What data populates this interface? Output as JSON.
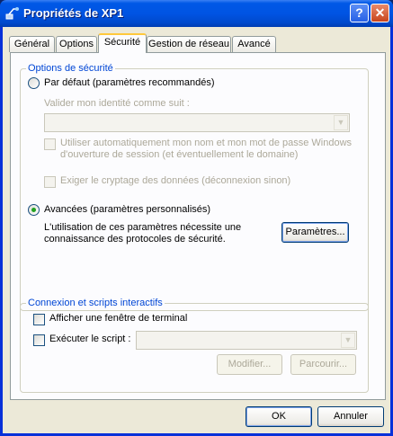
{
  "window": {
    "title": "Propriétés de XP1",
    "help_label": "?",
    "close_label": "✕"
  },
  "tabs": [
    {
      "label": "Général",
      "active": false
    },
    {
      "label": "Options",
      "active": false
    },
    {
      "label": "Sécurité",
      "active": true
    },
    {
      "label": "Gestion de réseau",
      "active": false
    },
    {
      "label": "Avancé",
      "active": false
    }
  ],
  "security_options": {
    "group_title": "Options de sécurité",
    "default_radio_label": "Par défaut (paramètres recommandés)",
    "default_checked": false,
    "validate_label": "Valider mon identité comme suit :",
    "validate_value": "",
    "auto_credentials_label_line1": "Utiliser automatiquement mon nom et mon mot de passe Windows",
    "auto_credentials_label_line2": "d'ouverture de session (et éventuellement le domaine)",
    "require_encryption_label": "Exiger le cryptage des données (déconnexion sinon)",
    "advanced_radio_label": "Avancées (paramètres personnalisés)",
    "advanced_checked": true,
    "advanced_note_line1": "L'utilisation de ces paramètres nécessite une",
    "advanced_note_line2": "connaissance des protocoles de sécurité.",
    "settings_button_label": "Paramètres..."
  },
  "interactive": {
    "group_title": "Connexion et scripts interactifs",
    "show_terminal_label": "Afficher une fenêtre de terminal",
    "show_terminal_checked": false,
    "run_script_label": "Exécuter le script :",
    "run_script_checked": false,
    "script_value": "",
    "modify_button_label": "Modifier...",
    "browse_button_label": "Parcourir..."
  },
  "footer": {
    "ok_label": "OK",
    "cancel_label": "Annuler"
  }
}
